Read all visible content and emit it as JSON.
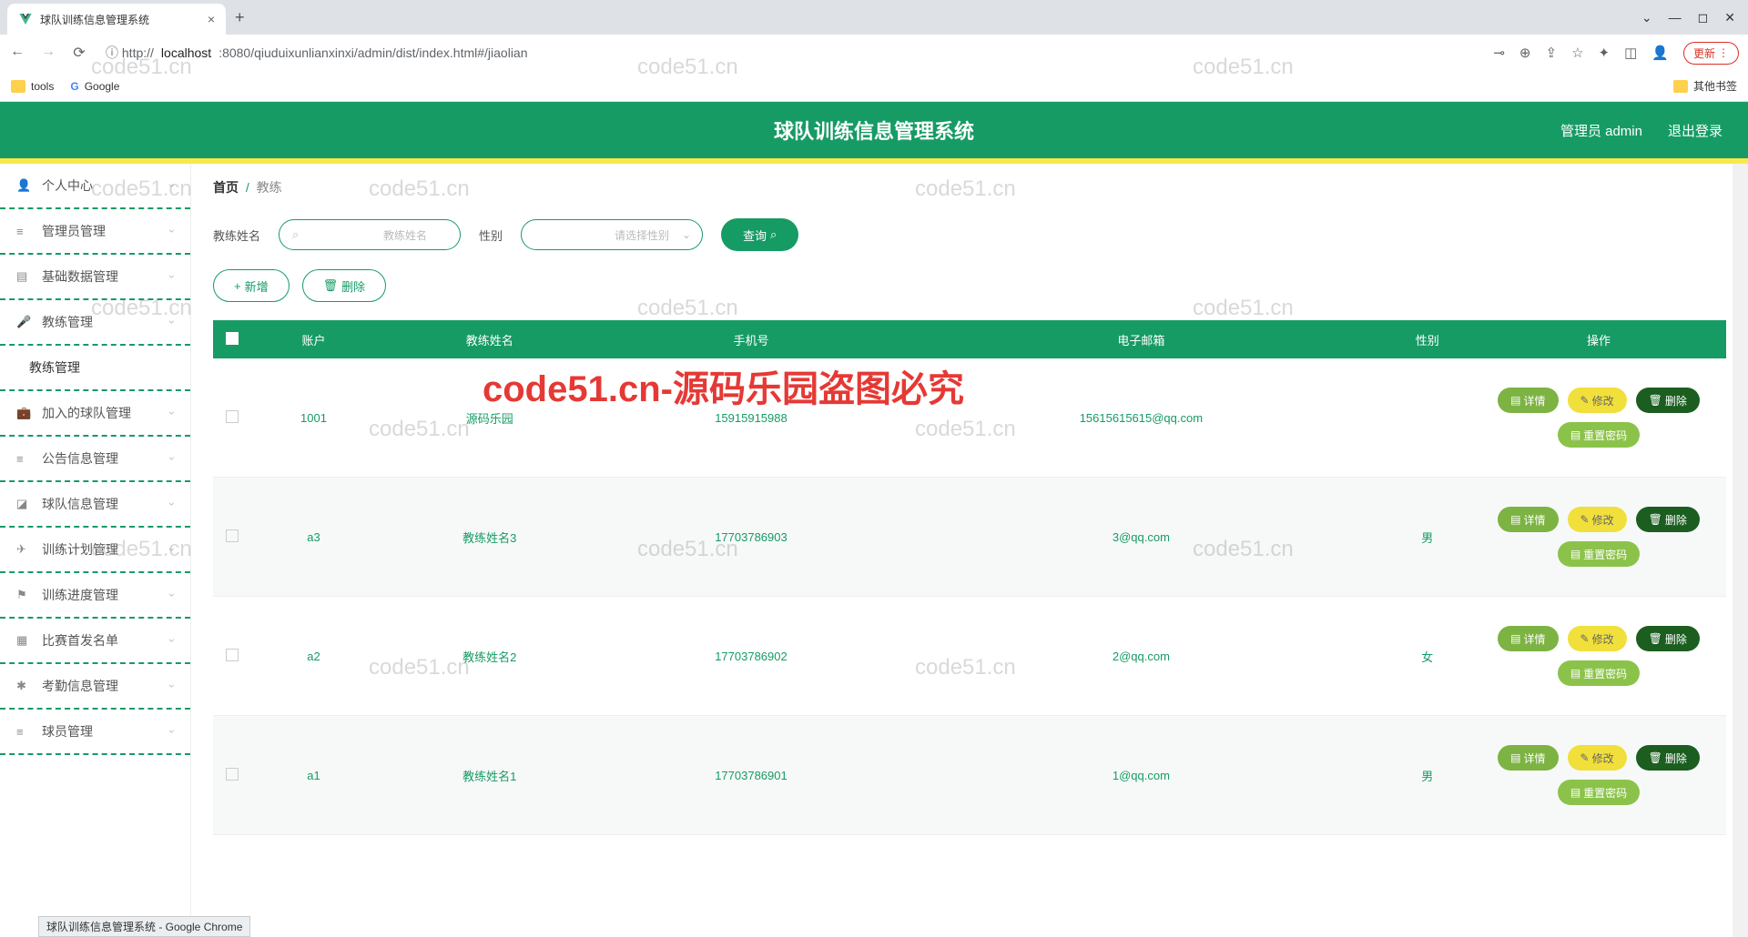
{
  "browser": {
    "tab_title": "球队训练信息管理系统",
    "url_proto": "ⓘ  http://",
    "url_host": "localhost",
    "url_path": ":8080/qiuduixunlianxinxi/admin/dist/index.html#/jiaolian",
    "update": "更新",
    "bm_tools": "tools",
    "bm_google": "Google",
    "bm_other": "其他书签"
  },
  "header": {
    "title": "球队训练信息管理系统",
    "user": "管理员 admin",
    "logout": "退出登录"
  },
  "sidebar": {
    "items": [
      {
        "icon": "👤",
        "label": "个人中心"
      },
      {
        "icon": "≡",
        "label": "管理员管理"
      },
      {
        "icon": "▤",
        "label": "基础数据管理"
      },
      {
        "icon": "🎤",
        "label": "教练管理"
      },
      {
        "icon": "",
        "label": "教练管理",
        "active": true
      },
      {
        "icon": "💼",
        "label": "加入的球队管理"
      },
      {
        "icon": "≡",
        "label": "公告信息管理"
      },
      {
        "icon": "◪",
        "label": "球队信息管理"
      },
      {
        "icon": "✈",
        "label": "训练计划管理"
      },
      {
        "icon": "⚑",
        "label": "训练进度管理"
      },
      {
        "icon": "▦",
        "label": "比赛首发名单"
      },
      {
        "icon": "✱",
        "label": "考勤信息管理"
      },
      {
        "icon": "≡",
        "label": "球员管理"
      }
    ]
  },
  "breadcrumb": {
    "home": "首页",
    "sep": "/",
    "cur": "教练"
  },
  "search": {
    "label_name": "教练姓名",
    "ph_name": "教练姓名",
    "label_gender": "性别",
    "ph_gender": "请选择性别",
    "query": "查询"
  },
  "actions": {
    "add": "新增",
    "del": "删除"
  },
  "table": {
    "headers": [
      "",
      "账户",
      "教练姓名",
      "手机号",
      "电子邮箱",
      "性别",
      "操作"
    ],
    "rows": [
      {
        "acct": "1001",
        "name": "源码乐园",
        "phone": "15915915988",
        "email": "15615615615@qq.com",
        "gender": ""
      },
      {
        "acct": "a3",
        "name": "教练姓名3",
        "phone": "17703786903",
        "email": "3@qq.com",
        "gender": "男"
      },
      {
        "acct": "a2",
        "name": "教练姓名2",
        "phone": "17703786902",
        "email": "2@qq.com",
        "gender": "女"
      },
      {
        "acct": "a1",
        "name": "教练姓名1",
        "phone": "17703786901",
        "email": "1@qq.com",
        "gender": "男"
      }
    ],
    "ops": {
      "detail": "详情",
      "edit": "修改",
      "del": "删除",
      "reset": "重置密码"
    }
  },
  "watermarks": {
    "text": "code51.cn",
    "red": "code51.cn-源码乐园盗图必究"
  },
  "status": "球队训练信息管理系统 - Google Chrome"
}
